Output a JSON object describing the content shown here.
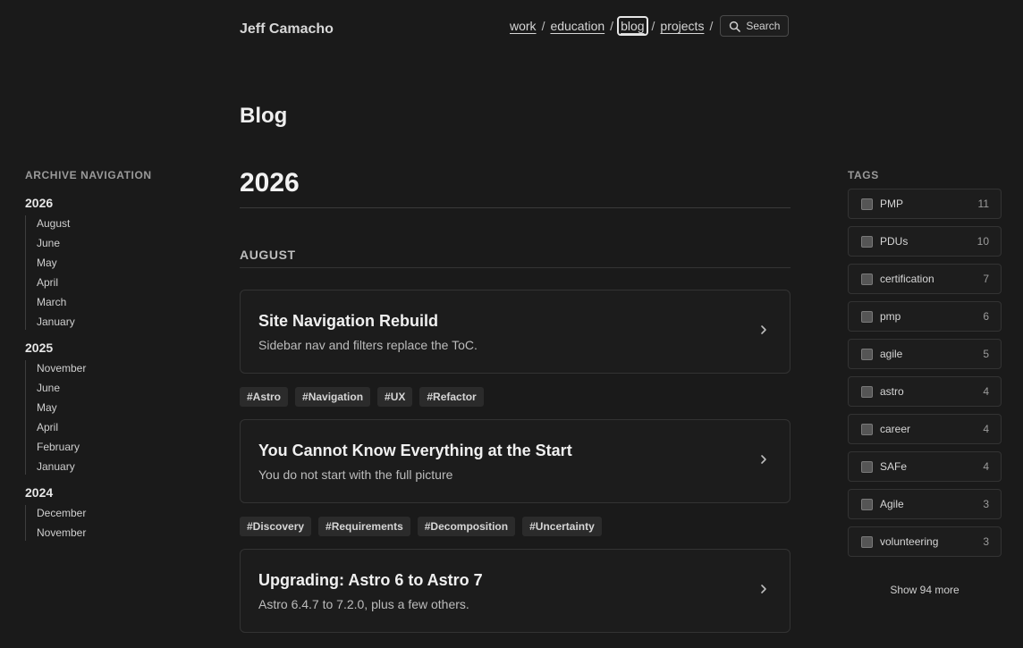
{
  "header": {
    "site_title": "Jeff Camacho",
    "nav": [
      "work",
      "education",
      "blog",
      "projects"
    ],
    "active_nav": "blog",
    "search_label": "Search"
  },
  "page_title": "Blog",
  "archive": {
    "heading": "ARCHIVE NAVIGATION",
    "years": [
      {
        "year": "2026",
        "months": [
          "August",
          "June",
          "May",
          "April",
          "March",
          "January"
        ]
      },
      {
        "year": "2025",
        "months": [
          "November",
          "June",
          "May",
          "April",
          "February",
          "January"
        ]
      },
      {
        "year": "2024",
        "months": [
          "December",
          "November"
        ]
      }
    ]
  },
  "main": {
    "year": "2026",
    "month": "AUGUST",
    "posts": [
      {
        "title": "Site Navigation Rebuild",
        "description": "Sidebar nav and filters replace the ToC.",
        "tags": [
          "#Astro",
          "#Navigation",
          "#UX",
          "#Refactor"
        ]
      },
      {
        "title": "You Cannot Know Everything at the Start",
        "description": "You do not start with the full picture",
        "tags": [
          "#Discovery",
          "#Requirements",
          "#Decomposition",
          "#Uncertainty"
        ]
      },
      {
        "title": "Upgrading: Astro 6 to Astro 7",
        "description": "Astro 6.4.7 to 7.2.0, plus a few others.",
        "tags": []
      }
    ]
  },
  "tags_sidebar": {
    "heading": "TAGS",
    "tags": [
      {
        "name": "PMP",
        "count": "11"
      },
      {
        "name": "PDUs",
        "count": "10"
      },
      {
        "name": "certification",
        "count": "7"
      },
      {
        "name": "pmp",
        "count": "6"
      },
      {
        "name": "agile",
        "count": "5"
      },
      {
        "name": "astro",
        "count": "4"
      },
      {
        "name": "career",
        "count": "4"
      },
      {
        "name": "SAFe",
        "count": "4"
      },
      {
        "name": "Agile",
        "count": "3"
      },
      {
        "name": "volunteering",
        "count": "3"
      }
    ],
    "show_more": "Show 94 more"
  },
  "icons": {
    "search": "search-icon",
    "chevron": "chevron-right-icon"
  }
}
